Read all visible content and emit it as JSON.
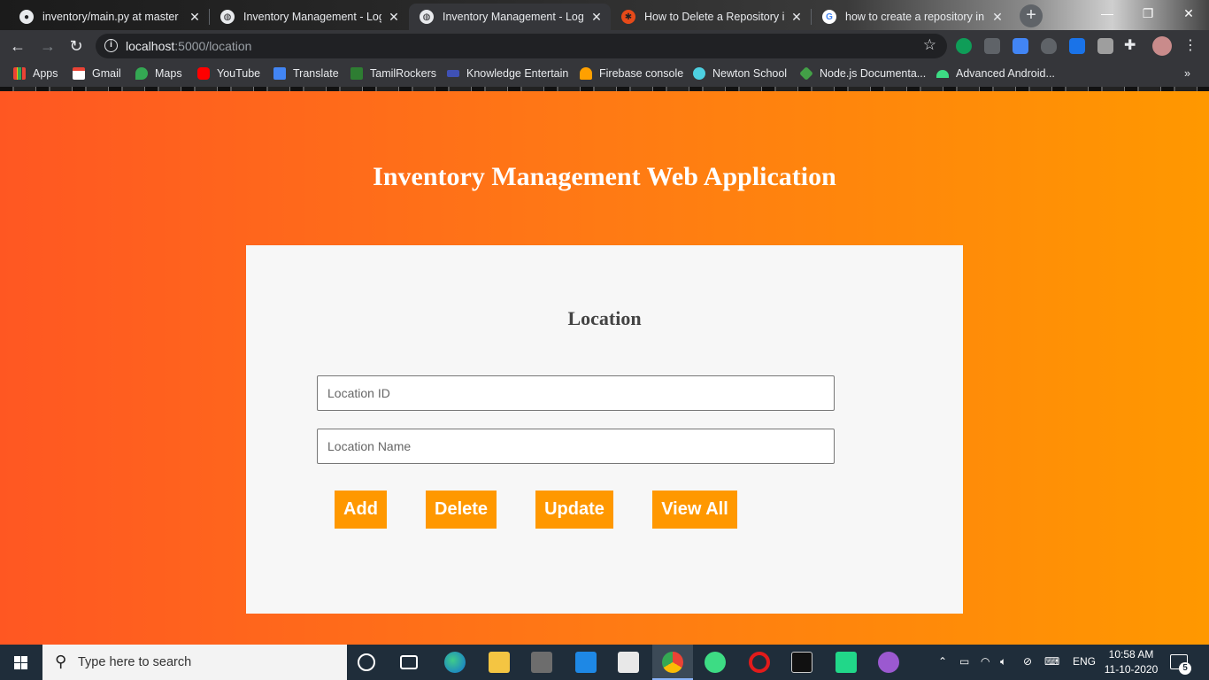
{
  "browser": {
    "tabs": [
      {
        "title": "inventory/main.py at master · l",
        "icon": "github-icon",
        "active": false
      },
      {
        "title": "Inventory Management - Login",
        "icon": "globe-icon",
        "active": true
      },
      {
        "title": "Inventory Management - Login",
        "icon": "globe-icon",
        "active": false
      },
      {
        "title": "How to Delete a Repository in G",
        "icon": "gear-icon",
        "active": false
      },
      {
        "title": "how to create a repository in g",
        "icon": "google-icon",
        "active": false
      }
    ],
    "url_host": "localhost",
    "url_path": ":5000/location",
    "bookmarks": [
      {
        "label": "Apps",
        "color": "#ea4335"
      },
      {
        "label": "Gmail",
        "color": "#ea4335"
      },
      {
        "label": "Maps",
        "color": "#34a853"
      },
      {
        "label": "YouTube",
        "color": "#ff0000"
      },
      {
        "label": "Translate",
        "color": "#4285f4"
      },
      {
        "label": "TamilRockers",
        "color": "#2e7d32"
      },
      {
        "label": "Knowledge Entertain",
        "color": "#3f51b5"
      },
      {
        "label": "Firebase console",
        "color": "#ffa000"
      },
      {
        "label": "Newton School",
        "color": "#4dd0e1"
      },
      {
        "label": "Node.js Documenta...",
        "color": "#43a047"
      },
      {
        "label": "Advanced Android...",
        "color": "#3ddc84"
      }
    ],
    "more_bookmarks": "»"
  },
  "page": {
    "title": "Inventory Management Web Application",
    "card_title": "Location",
    "fields": {
      "location_id_placeholder": "Location ID",
      "location_name_placeholder": "Location Name"
    },
    "buttons": {
      "add": "Add",
      "delete": "Delete",
      "update": "Update",
      "view_all": "View All"
    },
    "colors": {
      "gradient_start": "#ff5722",
      "gradient_end": "#ff9800",
      "button": "#ff9800",
      "card": "#f7f7f7"
    }
  },
  "taskbar": {
    "search_placeholder": "Type here to search",
    "language": "ENG",
    "time": "10:58 AM",
    "date": "11-10-2020",
    "notification_count": "5"
  }
}
